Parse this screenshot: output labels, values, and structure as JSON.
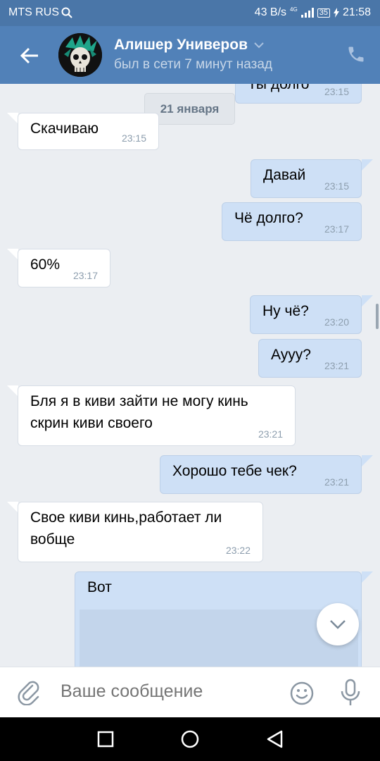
{
  "status_bar": {
    "carrier": "MTS RUS",
    "speed": "43 B/s",
    "network_type": "4G",
    "battery": "35",
    "time": "21:58"
  },
  "header": {
    "contact_name": "Алишер Универов",
    "contact_status": "был в сети 7 минут назад",
    "icons": [
      "back-arrow-icon",
      "chevron-down-icon",
      "phone-icon"
    ]
  },
  "chat": {
    "date_separator": "21 января",
    "messages": [
      {
        "dir": "out",
        "text": "Ты долго",
        "time": "23:15"
      },
      {
        "dir": "in",
        "text": "Скачиваю",
        "time": "23:15"
      },
      {
        "dir": "out",
        "text": "Давай",
        "time": "23:15"
      },
      {
        "dir": "out",
        "text": "Чё долго?",
        "time": "23:17"
      },
      {
        "dir": "in",
        "text": "60%",
        "time": "23:17"
      },
      {
        "dir": "out",
        "text": "Ну чё?",
        "time": "23:20"
      },
      {
        "dir": "out",
        "text": "Аууу?",
        "time": "23:21"
      },
      {
        "dir": "in",
        "text": "Бля я в киви зайти не могу кинь\nскрин киви своего",
        "time": "23:21"
      },
      {
        "dir": "out",
        "text": "Хорошо тебе чек?",
        "time": "23:21"
      },
      {
        "dir": "in",
        "text": "Свое киви кинь,работает ли\nвобще",
        "time": "23:22"
      },
      {
        "dir": "out",
        "text": "Вот",
        "time": ""
      }
    ]
  },
  "composer": {
    "placeholder": "Ваше сообщение",
    "icons": [
      "paperclip-icon",
      "emoji-icon",
      "microphone-icon"
    ]
  },
  "nav_bar": {
    "icons": [
      "square-icon",
      "circle-icon",
      "triangle-back-icon"
    ]
  },
  "colors": {
    "header": "#5181b8",
    "status_bar": "#4a76a8",
    "chat_background": "#ebeef2",
    "incoming_bubble": "#ffffff",
    "outgoing_bubble": "#cee0f6"
  }
}
